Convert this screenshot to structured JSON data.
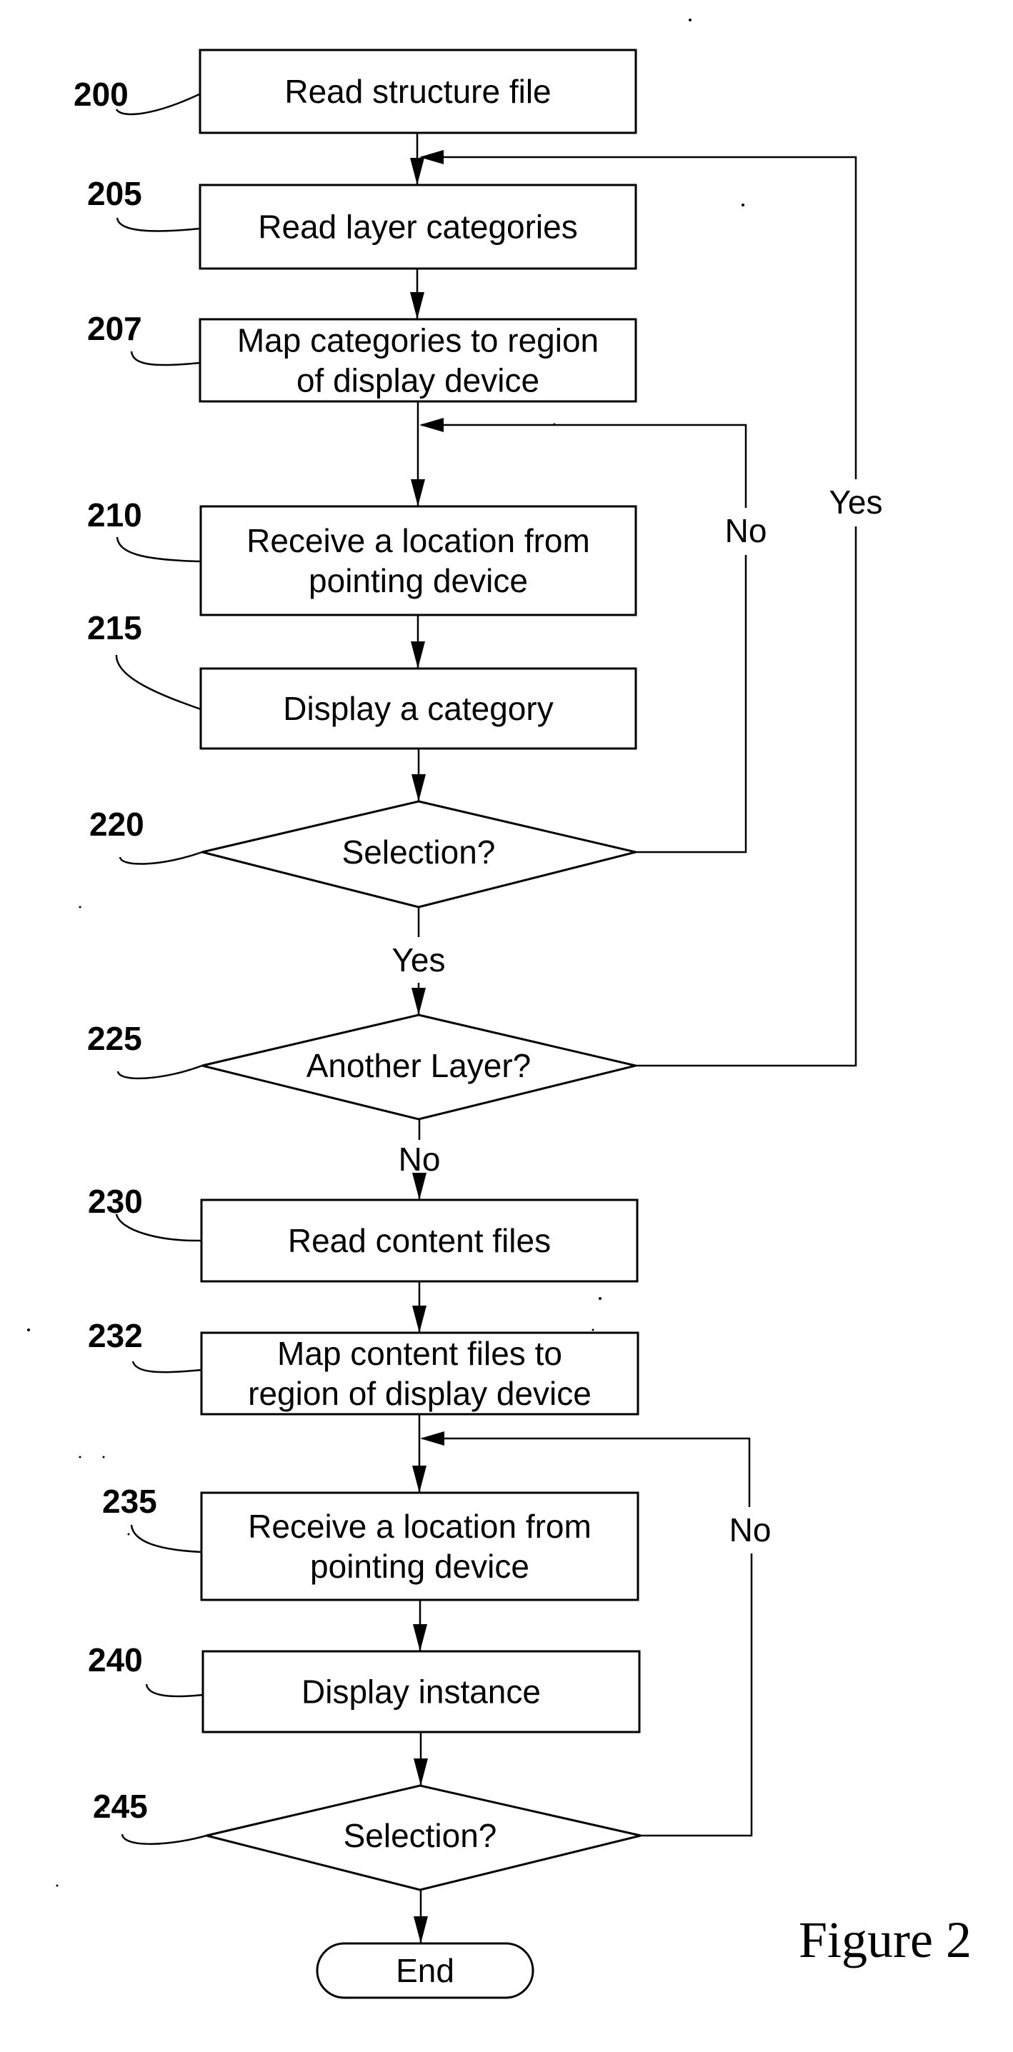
{
  "figure": {
    "caption": "Figure 2"
  },
  "nodes": [
    {
      "id": "200",
      "ref": "200",
      "type": "process",
      "lines": [
        "Read structure file"
      ]
    },
    {
      "id": "205",
      "ref": "205",
      "type": "process",
      "lines": [
        "Read layer categories"
      ]
    },
    {
      "id": "207",
      "ref": "207",
      "type": "process",
      "lines": [
        "Map categories to region",
        "of display device"
      ]
    },
    {
      "id": "210",
      "ref": "210",
      "type": "process",
      "lines": [
        "Receive a location from",
        "pointing device"
      ]
    },
    {
      "id": "215",
      "ref": "215",
      "type": "process",
      "lines": [
        "Display a category"
      ]
    },
    {
      "id": "220",
      "ref": "220",
      "type": "decision",
      "lines": [
        "Selection?"
      ]
    },
    {
      "id": "225",
      "ref": "225",
      "type": "decision",
      "lines": [
        "Another Layer?"
      ]
    },
    {
      "id": "230",
      "ref": "230",
      "type": "process",
      "lines": [
        "Read content files"
      ]
    },
    {
      "id": "232",
      "ref": "232",
      "type": "process",
      "lines": [
        "Map content files to",
        "region of display device"
      ]
    },
    {
      "id": "235",
      "ref": "235",
      "type": "process",
      "lines": [
        "Receive a location from",
        "pointing device"
      ]
    },
    {
      "id": "240",
      "ref": "240",
      "type": "process",
      "lines": [
        "Display instance"
      ]
    },
    {
      "id": "245",
      "ref": "245",
      "type": "decision",
      "lines": [
        "Selection?"
      ]
    },
    {
      "id": "end",
      "ref": "",
      "type": "terminator",
      "lines": [
        "End"
      ]
    }
  ],
  "edges": [
    {
      "from": "200",
      "to": "205",
      "label": ""
    },
    {
      "from": "205",
      "to": "207",
      "label": ""
    },
    {
      "from": "207",
      "to": "210",
      "label": ""
    },
    {
      "from": "210",
      "to": "215",
      "label": ""
    },
    {
      "from": "215",
      "to": "220",
      "label": ""
    },
    {
      "from": "220",
      "to": "225",
      "label": "Yes"
    },
    {
      "from": "220",
      "to": "210",
      "label": "No"
    },
    {
      "from": "225",
      "to": "205",
      "label": "Yes"
    },
    {
      "from": "225",
      "to": "230",
      "label": "No"
    },
    {
      "from": "230",
      "to": "232",
      "label": ""
    },
    {
      "from": "232",
      "to": "235",
      "label": ""
    },
    {
      "from": "235",
      "to": "240",
      "label": ""
    },
    {
      "from": "240",
      "to": "245",
      "label": ""
    },
    {
      "from": "245",
      "to": "end",
      "label": ""
    },
    {
      "from": "245",
      "to": "235",
      "label": "No"
    }
  ],
  "colors": {
    "ink": "#000000",
    "paper": "#ffffff"
  }
}
